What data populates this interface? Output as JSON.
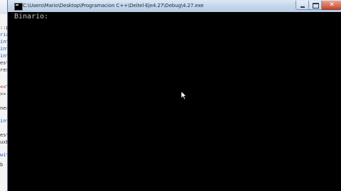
{
  "window": {
    "title": "C:\\Users\\Mario\\Desktop\\Programacion C++\\Deitel-Eje4.27\\Debug\\4.27.exe",
    "minimize_glyph": "minimize-icon",
    "maximize_glyph": "maximize-icon",
    "close_glyph": "✕"
  },
  "console": {
    "output": "Binario:"
  },
  "editor": {
    "lines": [
      {
        "text": "::pc",
        "kind": "plain"
      },
      {
        "text": "rial",
        "kind": "kw"
      },
      {
        "text": "int",
        "kind": "kw"
      },
      {
        "text": "int",
        "kind": "kw"
      },
      {
        "text": "int",
        "kind": "kw"
      },
      {
        "text": "esta",
        "kind": "plain"
      },
      {
        "text": "resp",
        "kind": "plain"
      },
      {
        "text": "<<\"",
        "kind": "str"
      },
      {
        "text": ">> r",
        "kind": "plain"
      },
      {
        "text": "ner",
        "kind": "plain"
      },
      {
        "text": "int",
        "kind": "kw"
      },
      {
        "text": "esta",
        "kind": "plain"
      },
      {
        "text": "uxB",
        "kind": "plain"
      },
      {
        "text": "wit",
        "kind": "kw"
      },
      {
        "text": "b",
        "kind": "plain"
      }
    ]
  },
  "colors": {
    "console_bg": "#000000",
    "console_fg": "#c0c0c0",
    "titlebar": "#c3d5ea",
    "close_button": "#c9452b"
  }
}
